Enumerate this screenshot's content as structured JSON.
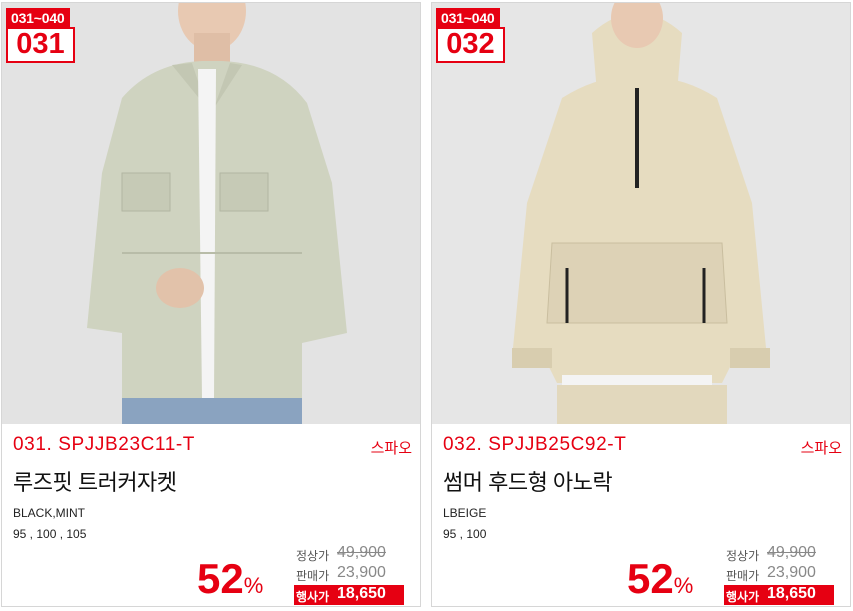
{
  "products": [
    {
      "range_badge": "031~040",
      "number_badge": "031",
      "code": "031. SPJJB23C11-T",
      "brand": "스파오",
      "name": "루즈핏 트러커자켓",
      "colors": "BLACK,MINT",
      "sizes": "95 , 100 , 105",
      "discount": "52",
      "discount_unit": "%",
      "regular_label": "정상가",
      "regular_price": "49,900",
      "sale_label": "판매가",
      "sale_price": "23,900",
      "event_label": "행사가",
      "event_price": "18,650",
      "garment_color": "#cfd3c0"
    },
    {
      "range_badge": "031~040",
      "number_badge": "032",
      "code": "032. SPJJB25C92-T",
      "brand": "스파오",
      "name": "썸머 후드형 아노락",
      "colors": "LBEIGE",
      "sizes": "95 , 100",
      "discount": "52",
      "discount_unit": "%",
      "regular_label": "정상가",
      "regular_price": "49,900",
      "sale_label": "판매가",
      "sale_price": "23,900",
      "event_label": "행사가",
      "event_price": "18,650",
      "garment_color": "#e6dcc0"
    }
  ],
  "accent_color": "#e60012"
}
